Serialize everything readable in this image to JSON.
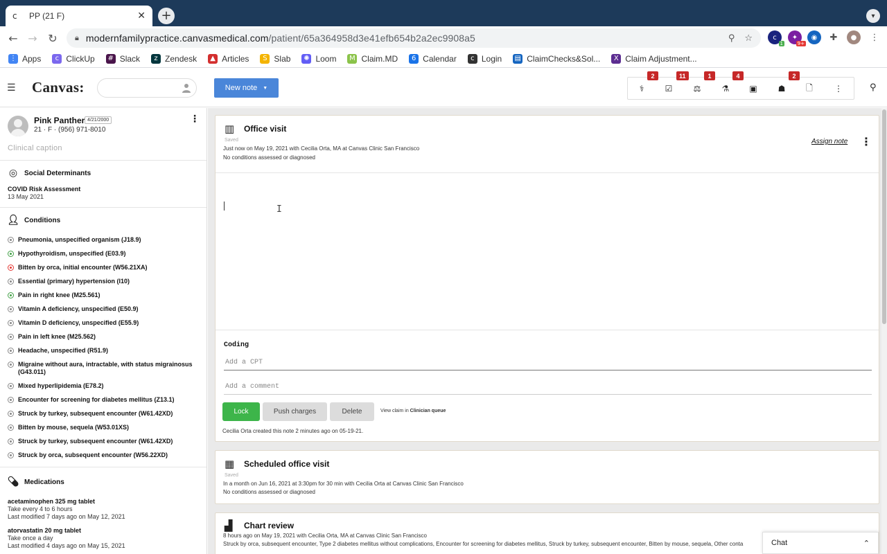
{
  "browser": {
    "tab_title": "PP (21 F)",
    "tab_favicon": "c",
    "close_glyph": "✕",
    "newtab_glyph": "+",
    "url_host": "modernfamilypractice.canvasmedical.com",
    "url_path": "/patient/65a364958d3e41efb654b2a2ec9908a5",
    "extension_badge_1": "1",
    "extension_badge_2": "9+"
  },
  "bookmarks": [
    {
      "label": "Apps",
      "icon": "apps-grid-icon",
      "color": "#4285f4"
    },
    {
      "label": "ClickUp",
      "icon": "clickup-icon",
      "color": "#7b68ee"
    },
    {
      "label": "Slack",
      "icon": "slack-icon",
      "color": "#4a154b"
    },
    {
      "label": "Zendesk",
      "icon": "zendesk-icon",
      "color": "#03363d"
    },
    {
      "label": "Articles",
      "icon": "articles-icon",
      "color": "#d32f2f"
    },
    {
      "label": "Slab",
      "icon": "slab-icon",
      "color": "#f4b400"
    },
    {
      "label": "Loom",
      "icon": "loom-icon",
      "color": "#625df5"
    },
    {
      "label": "Claim.MD",
      "icon": "claimmd-icon",
      "color": "#8bc34a"
    },
    {
      "label": "Calendar",
      "icon": "calendar-icon",
      "color": "#1a73e8"
    },
    {
      "label": "Login",
      "icon": "login-icon",
      "color": "#333333"
    },
    {
      "label": "ClaimChecks&Sol...",
      "icon": "doc-icon",
      "color": "#1565c0"
    },
    {
      "label": "Claim Adjustment...",
      "icon": "x-icon",
      "color": "#5c2d91"
    }
  ],
  "app": {
    "logo": "Canvas:",
    "new_note_label": "New note",
    "badges": [
      "2",
      "11",
      "1",
      "4",
      "2"
    ]
  },
  "patient": {
    "name": "Pink Panther",
    "dob": "4/21/2000",
    "info": "21 · F · (956) 971-8010",
    "caption": "Clinical caption"
  },
  "social": {
    "heading": "Social Determinants",
    "item_title": "COVID Risk Assessment",
    "item_date": "13 May 2021"
  },
  "conditions": {
    "heading": "Conditions",
    "items": [
      {
        "label": "Pneumonia, unspecified organism (J18.9)",
        "status": "grey"
      },
      {
        "label": "Hypothyroidism, unspecified (E03.9)",
        "status": "green"
      },
      {
        "label": "Bitten by orca, initial encounter (W56.21XA)",
        "status": "red"
      },
      {
        "label": "Essential (primary) hypertension (I10)",
        "status": "grey"
      },
      {
        "label": "Pain in right knee (M25.561)",
        "status": "green"
      },
      {
        "label": "Vitamin A deficiency, unspecified (E50.9)",
        "status": "grey"
      },
      {
        "label": "Vitamin D deficiency, unspecified (E55.9)",
        "status": "grey"
      },
      {
        "label": "Pain in left knee (M25.562)",
        "status": "grey"
      },
      {
        "label": "Headache, unspecified (R51.9)",
        "status": "grey"
      },
      {
        "label": "Migraine without aura, intractable, with status migrainosus (G43.011)",
        "status": "grey"
      },
      {
        "label": "Mixed hyperlipidemia (E78.2)",
        "status": "grey"
      },
      {
        "label": "Encounter for screening for diabetes mellitus (Z13.1)",
        "status": "grey"
      },
      {
        "label": "Struck by turkey, subsequent encounter (W61.42XD)",
        "status": "grey"
      },
      {
        "label": "Bitten by mouse, sequela (W53.01XS)",
        "status": "grey"
      },
      {
        "label": "Struck by turkey, subsequent encounter (W61.42XD)",
        "status": "grey"
      },
      {
        "label": "Struck by orca, subsequent encounter (W56.22XD)",
        "status": "grey"
      }
    ]
  },
  "medications": {
    "heading": "Medications",
    "items": [
      {
        "name": "acetaminophen 325 mg tablet",
        "sig": "Take every 4 to 6 hours",
        "modified": "Last modified 7 days ago on May 12, 2021"
      },
      {
        "name": "atorvastatin 20 mg tablet",
        "sig": "Take once a day",
        "modified": "Last modified 4 days ago on May 15, 2021"
      }
    ]
  },
  "office_visit": {
    "title": "Office visit",
    "saved": "Saved",
    "meta": "Just now on May 19, 2021 with Cecilia Orta, MA at Canvas Clinic San Francisco",
    "conditions": "No conditions assessed or diagnosed",
    "assign_label": "Assign note",
    "ibeam": "I",
    "coding_label": "Coding",
    "cpt_placeholder": "Add a CPT",
    "comment_placeholder": "Add a comment",
    "lock_label": "Lock",
    "push_label": "Push charges",
    "delete_label": "Delete",
    "view_claim_prefix": "View claim in",
    "view_claim_link": "Clinician queue",
    "created": "Cecilia Orta created this note 2 minutes ago on 05-19-21."
  },
  "scheduled_visit": {
    "title": "Scheduled office visit",
    "saved": "Saved",
    "meta": "In a month on Jun 16, 2021 at 3:30pm for 30 min with Cecilia Orta at Canvas Clinic San Francisco",
    "conditions": "No conditions assessed or diagnosed"
  },
  "chart_review": {
    "title": "Chart review",
    "meta": "8 hours ago on May 19, 2021 with Cecilia Orta, MA at Canvas Clinic San Francisco",
    "conditions": "Struck by orca, subsequent encounter, Type 2 diabetes mellitus without complications, Encounter for screening for diabetes mellitus, Struck by turkey, subsequent encounter, Bitten by mouse, sequela, Other conta"
  },
  "chat": {
    "label": "Chat"
  }
}
